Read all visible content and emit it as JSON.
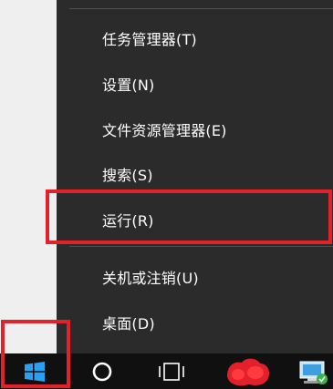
{
  "context_menu": {
    "items": [
      {
        "label": "任务管理器(T)"
      },
      {
        "label": "设置(N)"
      },
      {
        "label": "文件资源管理器(E)"
      },
      {
        "label": "搜索(S)"
      },
      {
        "label": "运行(R)"
      },
      {
        "label": "关机或注销(U)"
      },
      {
        "label": "桌面(D)"
      }
    ]
  },
  "taskbar": {
    "icons": [
      {
        "name": "windows-logo-icon"
      },
      {
        "name": "cortana-circle-icon"
      },
      {
        "name": "task-view-icon"
      },
      {
        "name": "red-app-icon"
      },
      {
        "name": "network-app-icon"
      }
    ]
  },
  "colors": {
    "menu_bg": "#2b2b2b",
    "menu_text": "#ffffff",
    "highlight": "#e3212a",
    "taskbar_bg": "#101010",
    "windows_blue": "#2aa0f0"
  }
}
